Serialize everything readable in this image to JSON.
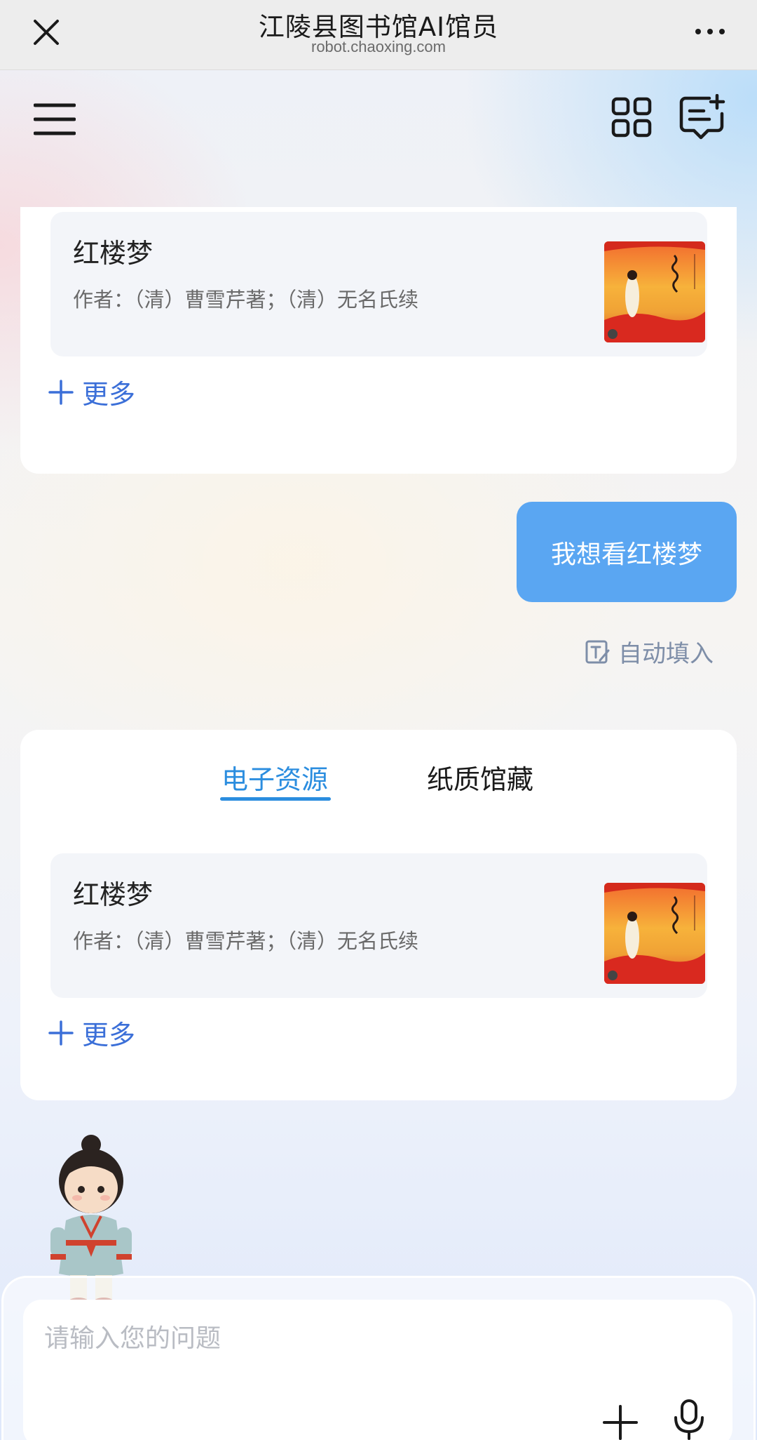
{
  "browser": {
    "title": "江陵县图书馆AI馆员",
    "url": "robot.chaoxing.com"
  },
  "result_card_1": {
    "book": {
      "title": "红楼梦",
      "author": "作者：（清）曹雪芹著；（清）无名氏续"
    },
    "more_label": "更多"
  },
  "user_message": {
    "text": "我想看红楼梦"
  },
  "autofill": {
    "label": "自动填入"
  },
  "result_card_2": {
    "tabs": [
      {
        "label": "电子资源",
        "active": true
      },
      {
        "label": "纸质馆藏",
        "active": false
      }
    ],
    "book": {
      "title": "红楼梦",
      "author": "作者：（清）曹雪芹著；（清）无名氏续"
    },
    "more_label": "更多"
  },
  "input": {
    "placeholder": "请输入您的问题"
  },
  "icons": {
    "close": "close-icon",
    "more": "more-dots-icon",
    "menu": "menu-icon",
    "apps": "grid-icon",
    "new_chat": "new-chat-icon",
    "plus": "plus-icon",
    "mic": "microphone-icon",
    "autofill": "edit-icon"
  },
  "colors": {
    "accent": "#2b8ddf",
    "link": "#3b6fd8",
    "bubble": "#5aa6f2"
  }
}
